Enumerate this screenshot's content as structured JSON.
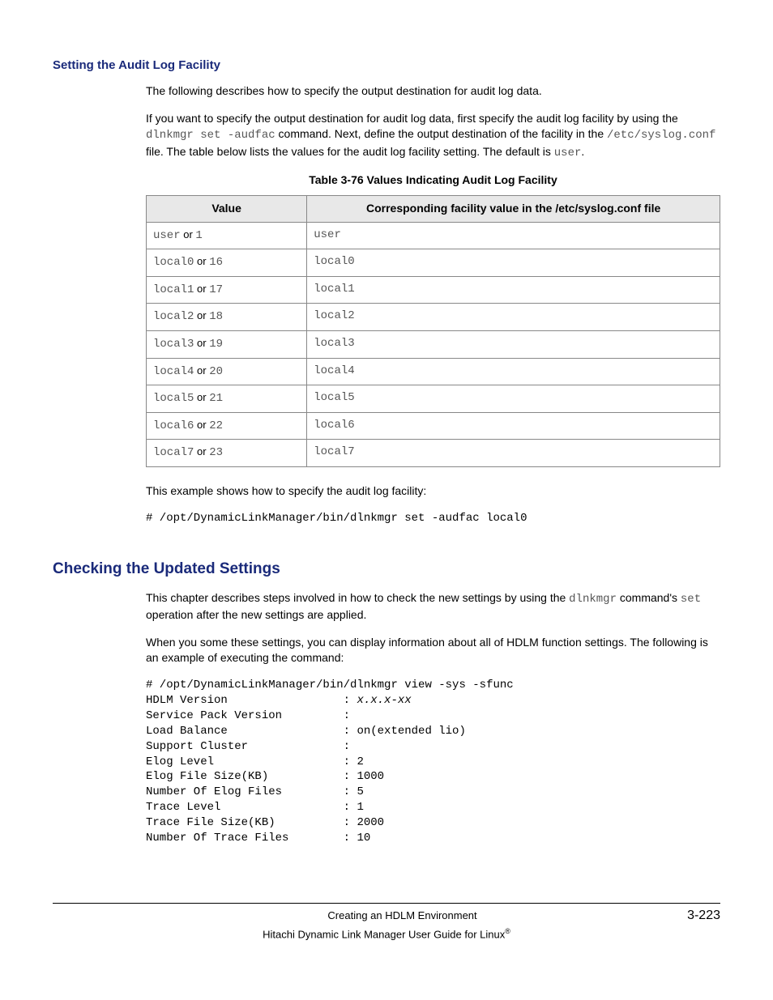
{
  "section1": {
    "heading": "Setting the Audit Log Facility",
    "para1": "The following describes how to specify the output destination for audit log data.",
    "para2a": "If you want to specify the output destination for audit log data, first specify the audit log facility by using the ",
    "para2b": "dlnkmgr set -audfac",
    "para2c": " command. Next, define the output destination of the facility in the ",
    "para2d": "/etc/syslog.conf",
    "para2e": " file. The table below lists the values for the audit log facility setting. The default is ",
    "para2f": "user",
    "para2g": ".",
    "tableCaption": "Table 3-76 Values Indicating Audit Log Facility",
    "th1": "Value",
    "th2": "Corresponding facility value in the /etc/syslog.conf file",
    "rows": [
      {
        "v1a": "user",
        "v1b": " or ",
        "v1c": "1",
        "v2": "user"
      },
      {
        "v1a": "local0",
        "v1b": " or ",
        "v1c": "16",
        "v2": "local0"
      },
      {
        "v1a": "local1",
        "v1b": " or ",
        "v1c": "17",
        "v2": "local1"
      },
      {
        "v1a": "local2",
        "v1b": " or ",
        "v1c": "18",
        "v2": "local2"
      },
      {
        "v1a": "local3",
        "v1b": " or ",
        "v1c": "19",
        "v2": "local3"
      },
      {
        "v1a": "local4",
        "v1b": " or ",
        "v1c": "20",
        "v2": "local4"
      },
      {
        "v1a": "local5",
        "v1b": " or ",
        "v1c": "21",
        "v2": "local5"
      },
      {
        "v1a": "local6",
        "v1b": " or ",
        "v1c": "22",
        "v2": "local6"
      },
      {
        "v1a": "local7",
        "v1b": " or ",
        "v1c": "23",
        "v2": "local7"
      }
    ],
    "para3": "This example shows how to specify the audit log facility:",
    "code1": "# /opt/DynamicLinkManager/bin/dlnkmgr set -audfac local0"
  },
  "section2": {
    "heading": "Checking the Updated Settings",
    "para1a": "This chapter describes steps involved in how to check the new settings by using the ",
    "para1b": "dlnkmgr",
    "para1c": " command's ",
    "para1d": "set",
    "para1e": " operation after the new settings are applied.",
    "para2": "When you some these settings, you can display information about all of HDLM function settings. The following is an example of executing the command:",
    "code2": "# /opt/DynamicLinkManager/bin/dlnkmgr view -sys -sfunc\nHDLM Version                 : x.x.x-xx\nService Pack Version         :\nLoad Balance                 : on(extended lio)\nSupport Cluster              :\nElog Level                   : 2\nElog File Size(KB)           : 1000\nNumber Of Elog Files         : 5\nTrace Level                  : 1\nTrace File Size(KB)          : 2000\nNumber Of Trace Files        : 10"
  },
  "footer": {
    "center": "Creating an HDLM Environment",
    "page": "3-223",
    "sub": "Hitachi Dynamic Link Manager User Guide for Linux"
  }
}
